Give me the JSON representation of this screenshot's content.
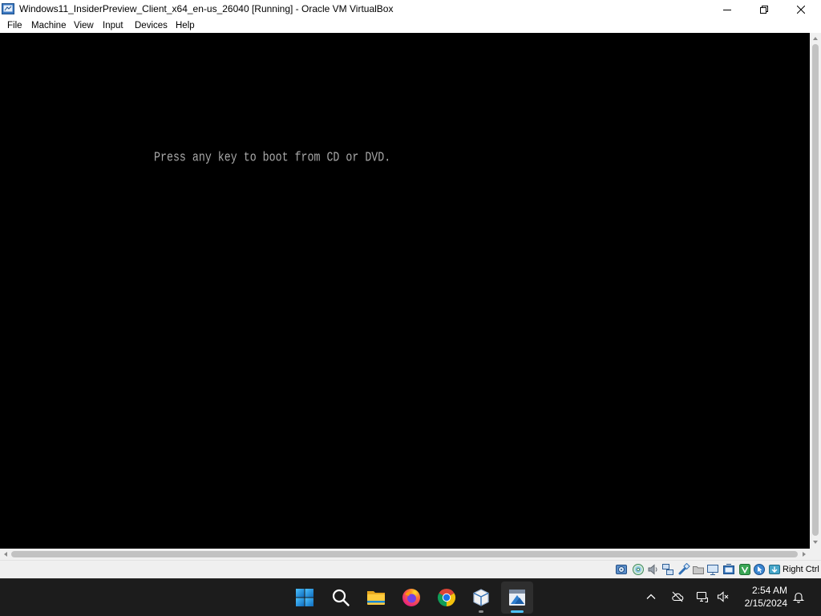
{
  "window": {
    "title": "Windows11_InsiderPreview_Client_x64_en-us_26040 [Running] - Oracle VM VirtualBox",
    "app_icon": "vm-os-icon",
    "controls": [
      "minimize-icon",
      "restore-icon",
      "close-icon"
    ]
  },
  "menu": {
    "items": [
      "File",
      "Machine",
      "View",
      "Input",
      "Devices",
      "Help"
    ]
  },
  "vm_screen": {
    "boot_message": "Press any key to boot from CD or DVD."
  },
  "status_bar": {
    "indicators": [
      "hard-disk-icon",
      "optical-drive-icon",
      "audio-icon",
      "network-icon",
      "usb-icon",
      "shared-folders-icon",
      "display-icon",
      "recording-icon",
      "virtualization-icon",
      "mouse-integration-icon",
      "keyboard-capture-icon"
    ],
    "host_key": "Right Ctrl"
  },
  "taskbar": {
    "apps": [
      "windows-start-icon",
      "search-icon",
      "file-explorer-icon",
      "firefox-icon",
      "chrome-icon",
      "virtualbox-manager-icon",
      "virtualbox-vm-icon"
    ],
    "active_app": "virtualbox-vm-icon",
    "tray": {
      "icons": [
        "chevron-up-icon",
        "cloud-offline-icon",
        "ethernet-network-icon",
        "volume-muted-icon"
      ],
      "time": "2:54 AM",
      "date": "2/15/2024",
      "notification_icon": "notification-bell-icon"
    }
  },
  "colors": {
    "title_bar": "#ffffff",
    "menu_bar": "#ffffff",
    "status_bar": "#f0f0f0",
    "taskbar": "#1c1c1c",
    "accent": "#4cc2ff",
    "vm_background": "#000000",
    "vm_text": "#a8a8a8"
  }
}
